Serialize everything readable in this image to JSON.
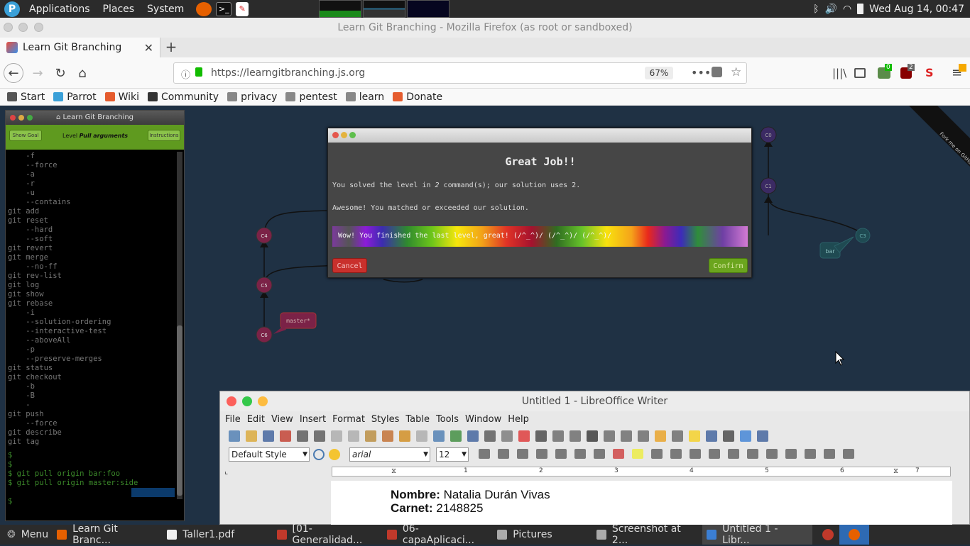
{
  "top_panel": {
    "menus": [
      "Applications",
      "Places",
      "System"
    ],
    "clock": "Wed Aug 14, 00:47"
  },
  "firefox": {
    "window_title": "Learn Git Branching - Mozilla Firefox (as root or sandboxed)",
    "tab_title": "Learn Git Branching",
    "url": "https://learngitbranching.js.org",
    "zoom": "67%",
    "badge_green": "0",
    "badge_red": "2",
    "bookmarks": [
      {
        "label": "Start",
        "icon": "star-icon",
        "color": "#555555"
      },
      {
        "label": "Parrot",
        "icon": "parrot-icon",
        "color": "#3aa0d8"
      },
      {
        "label": "Wiki",
        "icon": "wiki-icon",
        "color": "#e55c2e"
      },
      {
        "label": "Community",
        "icon": "book-icon",
        "color": "#333333"
      },
      {
        "label": "privacy",
        "icon": "folder-icon",
        "color": "#888888"
      },
      {
        "label": "pentest",
        "icon": "folder-icon",
        "color": "#888888"
      },
      {
        "label": "learn",
        "icon": "folder-icon",
        "color": "#888888"
      },
      {
        "label": "Donate",
        "icon": "donate-icon",
        "color": "#e55c2e"
      }
    ]
  },
  "lgb_panel": {
    "title": "Learn Git Branching",
    "show_goal": "Show Goal",
    "instructions": "Instructions",
    "level_prefix": "Level",
    "level_name": "Pull arguments",
    "commands": [
      "    -f",
      "    --force",
      "    -a",
      "    -r",
      "    -u",
      "    --contains",
      "git add",
      "git reset",
      "    --hard",
      "    --soft",
      "git revert",
      "git merge",
      "    --no-ff",
      "git rev-list",
      "git log",
      "git show",
      "git rebase",
      "    -i",
      "    --solution-ordering",
      "    --interactive-test",
      "    --aboveAll",
      "    -p",
      "    --preserve-merges",
      "git status",
      "git checkout",
      "    -b",
      "    -B",
      "    -",
      "git push",
      "    --force",
      "git describe",
      "git tag"
    ],
    "history": [
      "$",
      "$",
      "$ git pull origin bar:foo",
      "$ git pull origin master:side",
      "",
      "$"
    ]
  },
  "tree": {
    "nodes": [
      "C4",
      "C5",
      "C6",
      "C0",
      "C1",
      "C3"
    ],
    "labels": {
      "master": "master*",
      "bar": "bar"
    },
    "fork_ribbon": "Fork me on GitHub"
  },
  "dialog": {
    "heading": "Great Job!!",
    "line1_a": "You solved the level in ",
    "line1_n": "2",
    "line1_b": " command(s); our solution uses 2.",
    "line2": "Awesome! You matched or exceeded our solution.",
    "rainbow_text": "Wow! You finished the last level, great! (/^_^)/ (/^_^)/ (/^_^)/",
    "cancel": "Cancel",
    "confirm": "Confirm"
  },
  "writer": {
    "title": "Untitled 1 - LibreOffice Writer",
    "menus": [
      "File",
      "Edit",
      "View",
      "Insert",
      "Format",
      "Styles",
      "Table",
      "Tools",
      "Window",
      "Help"
    ],
    "paragraph_style": "Default Style",
    "font_name": "arial",
    "font_size": "12",
    "ruler_numbers": [
      "1",
      "2",
      "3",
      "4",
      "5",
      "6",
      "7"
    ],
    "doc": {
      "name_label": "Nombre:",
      "name_value": "Natalia Durán Vivas",
      "carnet_label": "Carnet:",
      "carnet_value": "2148825"
    }
  },
  "taskbar": {
    "menu": "Menu",
    "items": [
      {
        "label": "Learn Git Branc...",
        "icon": "firefox-icon",
        "color": "#e66000",
        "active": false
      },
      {
        "label": "Taller1.pdf",
        "icon": "pdf-icon",
        "color": "#eeeeee",
        "active": false
      },
      {
        "label": "[01-Generalidad...",
        "icon": "pdf-icon",
        "color": "#c0392b",
        "active": false
      },
      {
        "label": "06-capaAplicaci...",
        "icon": "pdf-icon",
        "color": "#c0392b",
        "active": false
      },
      {
        "label": "Pictures",
        "icon": "folder-icon",
        "color": "#aaaaaa",
        "active": false
      },
      {
        "label": "Screenshot at 2...",
        "icon": "image-icon",
        "color": "#aaaaaa",
        "active": false
      },
      {
        "label": "Untitled 1 - Libr...",
        "icon": "writer-icon",
        "color": "#3b7fd4",
        "active": true
      }
    ]
  }
}
